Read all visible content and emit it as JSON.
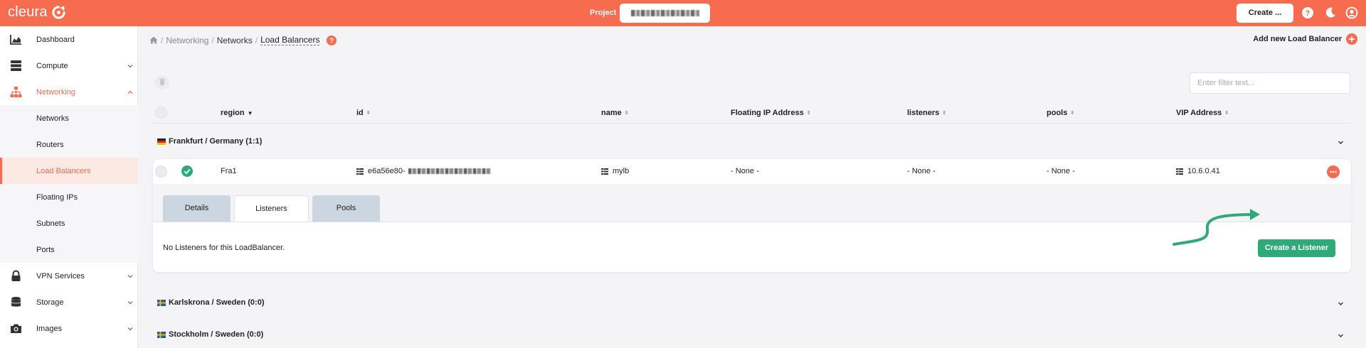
{
  "topbar": {
    "logo_text": "cleura",
    "project_label": "Project",
    "create_label": "Create ...",
    "colors": {
      "brand": "#f76b4e",
      "accent_green": "#2eaa7a"
    }
  },
  "sidebar": {
    "items": [
      {
        "label": "Dashboard",
        "icon": "chart-area-icon"
      },
      {
        "label": "Compute",
        "icon": "server-icon"
      },
      {
        "label": "Networking",
        "icon": "network-icon"
      },
      {
        "label": "Networks"
      },
      {
        "label": "Routers"
      },
      {
        "label": "Load Balancers"
      },
      {
        "label": "Floating IPs"
      },
      {
        "label": "Subnets"
      },
      {
        "label": "Ports"
      },
      {
        "label": "VPN Services",
        "icon": "lock-icon"
      },
      {
        "label": "Storage",
        "icon": "database-icon"
      },
      {
        "label": "Images",
        "icon": "camera-icon"
      }
    ]
  },
  "breadcrumb": {
    "networking": "Networking",
    "networks": "Networks",
    "current": "Load Balancers"
  },
  "header": {
    "add_new_label": "Add new Load Balancer"
  },
  "filter": {
    "placeholder": "Enter filter text..."
  },
  "table": {
    "columns": {
      "region": "region",
      "id": "id",
      "name": "name",
      "floating_ip": "Floating IP Address",
      "listeners": "listeners",
      "pools": "pools",
      "vip": "VIP Address"
    },
    "groups": [
      {
        "name": "Frankfurt / Germany (1:1)"
      },
      {
        "name": "Karlskrona / Sweden (0:0)"
      },
      {
        "name": "Stockholm / Sweden (0:0)"
      }
    ],
    "row": {
      "region": "Fra1",
      "id_prefix": "e6a56e80-",
      "name": "mylb",
      "floating_ip": "- None -",
      "listeners": "- None -",
      "pools": "- None -",
      "vip": "10.6.0.41"
    }
  },
  "detail": {
    "tabs": [
      "Details",
      "Listeners",
      "Pools"
    ],
    "active_tab": "Listeners",
    "empty_message": "No Listeners for this LoadBalancer.",
    "create_listener_label": "Create a Listener"
  }
}
